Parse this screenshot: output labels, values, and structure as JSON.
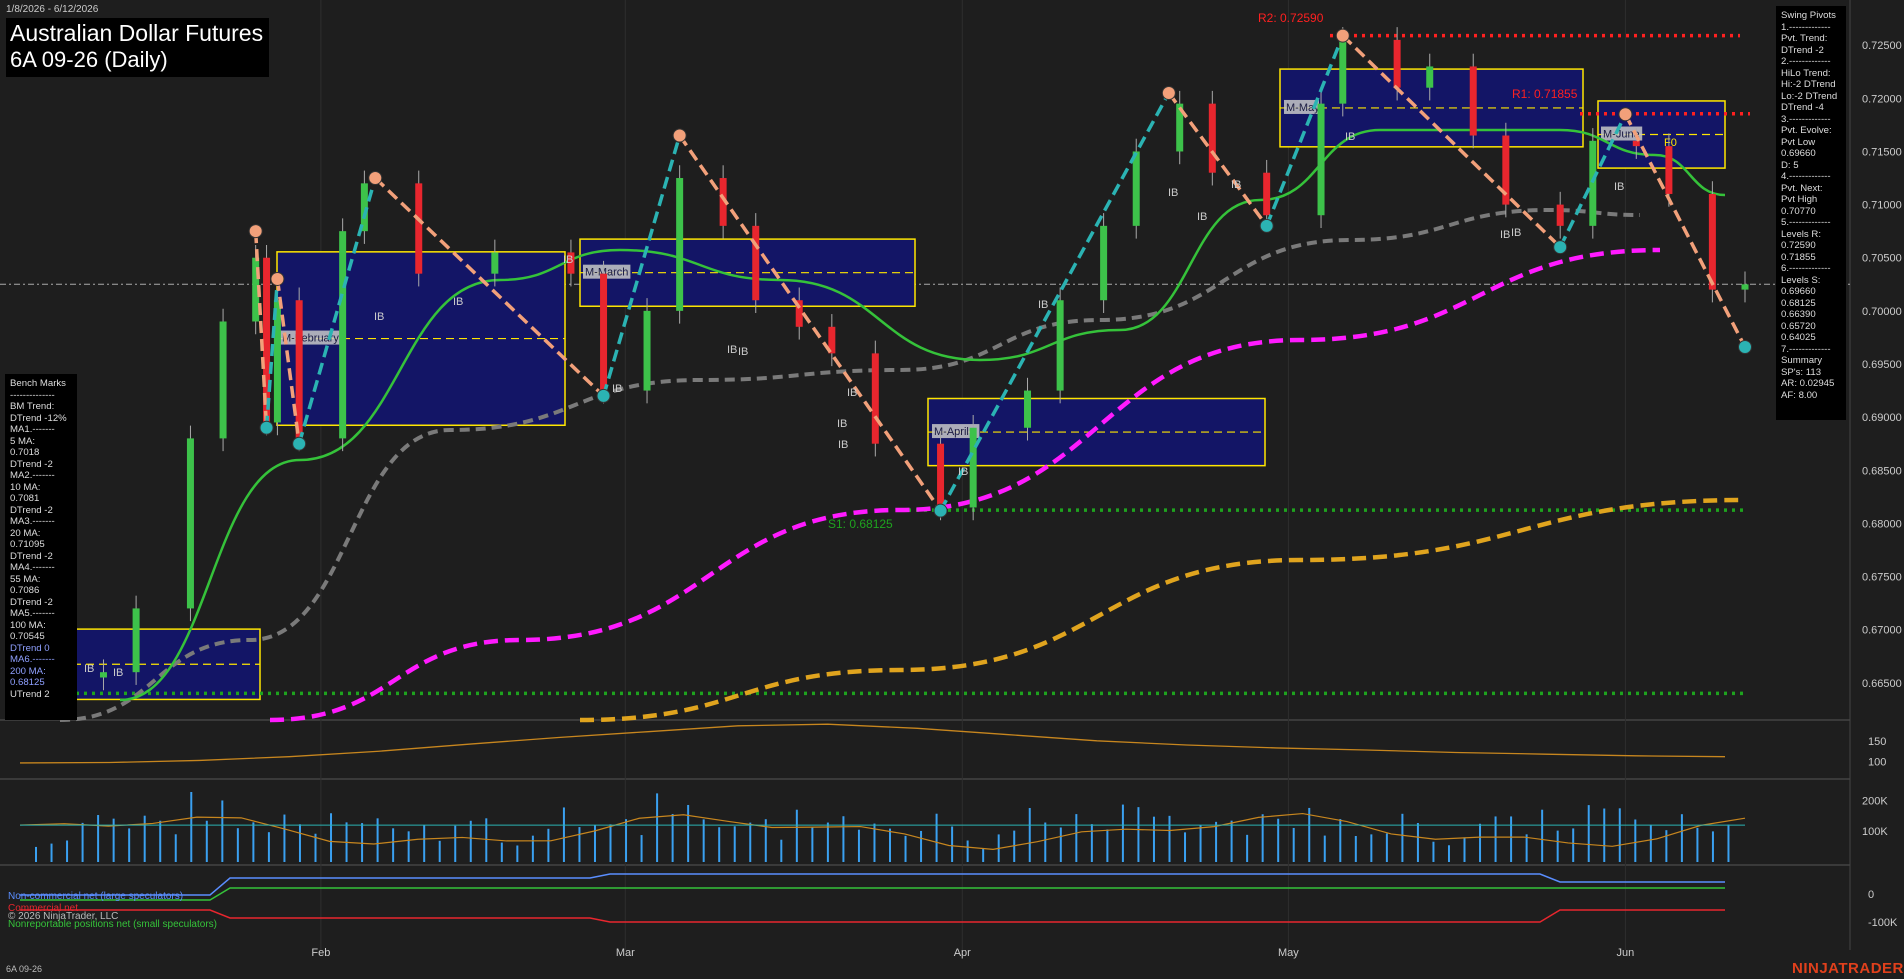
{
  "header": {
    "date_range": "1/8/2026 - 6/12/2026",
    "title": "Australian Dollar Futures",
    "subtitle": "6A 09-26 (Daily)"
  },
  "colors": {
    "background": "#1e1e1e",
    "up_candle": "#3dc24a",
    "down_candle": "#e8262e",
    "ma_green": "#35c23a",
    "ma_gray": "#7a7a7a",
    "ma_magenta": "#ff1aff",
    "ma_orange": "#e0a41e",
    "pivot_up_line": "#2bb3b3",
    "pivot_down_line": "#f2a07a",
    "resistance": "#ff2020",
    "support": "#1ea31e",
    "brand": "#e0401c"
  },
  "chart_data": [
    {
      "type": "candlestick",
      "title": "Australian Dollar Futures",
      "subtitle": "6A 09-26 (Daily)",
      "x_tick_labels": [
        "Feb",
        "Mar",
        "Apr",
        "May",
        "Jun"
      ],
      "y_tick_labels": [
        "0.72500",
        "0.72000",
        "0.71500",
        "0.71000",
        "0.70500",
        "0.70000",
        "0.69500",
        "0.69000",
        "0.68500",
        "0.68000",
        "0.67500",
        "0.67000",
        "0.66500"
      ],
      "ylim": [
        0.6615,
        0.7285
      ],
      "grid": false,
      "current_price": 0.7025,
      "close_series_approx": [
        {
          "date": "2026-01-08",
          "close": 0.6655
        },
        {
          "date": "2026-01-12",
          "close": 0.666
        },
        {
          "date": "2026-01-15",
          "close": 0.672
        },
        {
          "date": "2026-01-20",
          "close": 0.688
        },
        {
          "date": "2026-01-23",
          "close": 0.699
        },
        {
          "date": "2026-01-26",
          "close": 0.705
        },
        {
          "date": "2026-01-27",
          "close": 0.6895
        },
        {
          "date": "2026-01-28",
          "close": 0.701
        },
        {
          "date": "2026-01-30",
          "close": 0.688
        },
        {
          "date": "2026-02-03",
          "close": 0.7075
        },
        {
          "date": "2026-02-05",
          "close": 0.712
        },
        {
          "date": "2026-02-10",
          "close": 0.7035
        },
        {
          "date": "2026-02-17",
          "close": 0.7055
        },
        {
          "date": "2026-02-24",
          "close": 0.7035
        },
        {
          "date": "2026-02-27",
          "close": 0.6925
        },
        {
          "date": "2026-03-03",
          "close": 0.7
        },
        {
          "date": "2026-03-06",
          "close": 0.7125
        },
        {
          "date": "2026-03-10",
          "close": 0.708
        },
        {
          "date": "2026-03-13",
          "close": 0.701
        },
        {
          "date": "2026-03-17",
          "close": 0.6985
        },
        {
          "date": "2026-03-20",
          "close": 0.696
        },
        {
          "date": "2026-03-24",
          "close": 0.6875
        },
        {
          "date": "2026-03-30",
          "close": 0.6815
        },
        {
          "date": "2026-04-02",
          "close": 0.689
        },
        {
          "date": "2026-04-07",
          "close": 0.6925
        },
        {
          "date": "2026-04-10",
          "close": 0.701
        },
        {
          "date": "2026-04-14",
          "close": 0.708
        },
        {
          "date": "2026-04-17",
          "close": 0.715
        },
        {
          "date": "2026-04-21",
          "close": 0.7195
        },
        {
          "date": "2026-04-24",
          "close": 0.713
        },
        {
          "date": "2026-04-29",
          "close": 0.709
        },
        {
          "date": "2026-05-04",
          "close": 0.7195
        },
        {
          "date": "2026-05-06",
          "close": 0.7255
        },
        {
          "date": "2026-05-11",
          "close": 0.721
        },
        {
          "date": "2026-05-14",
          "close": 0.723
        },
        {
          "date": "2026-05-18",
          "close": 0.7165
        },
        {
          "date": "2026-05-21",
          "close": 0.71
        },
        {
          "date": "2026-05-26",
          "close": 0.708
        },
        {
          "date": "2026-05-29",
          "close": 0.716
        },
        {
          "date": "2026-06-02",
          "close": 0.7155
        },
        {
          "date": "2026-06-05",
          "close": 0.711
        },
        {
          "date": "2026-06-09",
          "close": 0.702
        },
        {
          "date": "2026-06-12",
          "close": 0.7025
        }
      ],
      "swing_pivots": [
        {
          "type": "high",
          "date": "2026-01-26",
          "price": 0.7075
        },
        {
          "type": "low",
          "date": "2026-01-27",
          "price": 0.689
        },
        {
          "type": "high",
          "date": "2026-01-28",
          "price": 0.703
        },
        {
          "type": "low",
          "date": "2026-01-30",
          "price": 0.6875
        },
        {
          "type": "high",
          "date": "2026-02-06",
          "price": 0.7125
        },
        {
          "type": "low",
          "date": "2026-02-27",
          "price": 0.692
        },
        {
          "type": "high",
          "date": "2026-03-06",
          "price": 0.7165
        },
        {
          "type": "low",
          "date": "2026-03-30",
          "price": 0.6812
        },
        {
          "type": "high",
          "date": "2026-04-20",
          "price": 0.7205
        },
        {
          "type": "low",
          "date": "2026-04-29",
          "price": 0.708
        },
        {
          "type": "high",
          "date": "2026-05-06",
          "price": 0.7259
        },
        {
          "type": "low",
          "date": "2026-05-26",
          "price": 0.706
        },
        {
          "type": "high",
          "date": "2026-06-01",
          "price": 0.7185
        },
        {
          "type": "low",
          "date": "2026-06-12",
          "price": 0.6966
        }
      ],
      "levels": [
        {
          "label": "R2: 0.72590",
          "value": 0.7259,
          "kind": "resistance"
        },
        {
          "label": "R1: 0.71855",
          "value": 0.71855,
          "kind": "resistance"
        },
        {
          "label": "S1: 0.68125",
          "value": 0.68125,
          "kind": "support"
        },
        {
          "label": "",
          "value": 0.664,
          "kind": "support"
        }
      ],
      "monthly_boxes": [
        {
          "label": "M-February",
          "high": 0.7048,
          "low": 0.6898
        },
        {
          "label": "M-March",
          "high": 0.706,
          "low": 0.701
        },
        {
          "label": "M-April",
          "high": 0.691,
          "low": 0.686
        },
        {
          "label": "M-May",
          "high": 0.722,
          "low": 0.716
        },
        {
          "label": "M-June",
          "high": 0.719,
          "low": 0.714
        },
        {
          "label": "",
          "high": 0.6693,
          "low": 0.664
        }
      ],
      "box_tags": [
        "F0"
      ],
      "inside_bar_tag": "IB",
      "moving_averages": [
        {
          "name": "20 MA",
          "color": "#35c23a",
          "value": 0.71095
        },
        {
          "name": "55 MA",
          "color": "#7a7a7a",
          "value": 0.7086
        },
        {
          "name": "100 MA",
          "color": "#ff1aff",
          "value": 0.70545
        },
        {
          "name": "200 MA",
          "color": "#e0a41e",
          "value": 0.68125
        }
      ]
    },
    {
      "type": "line",
      "title": "",
      "y_tick_labels": [
        "150",
        "100"
      ],
      "series": [
        {
          "values": [
            97,
            98,
            103,
            112,
            125,
            142,
            158,
            172,
            186,
            190,
            180,
            165,
            150,
            140,
            133,
            128,
            122,
            118,
            114,
            112
          ]
        }
      ]
    },
    {
      "type": "bar",
      "title": "",
      "y_tick_labels": [
        "200K",
        "100K"
      ],
      "ylim": [
        0,
        260000
      ],
      "series": [
        {
          "name": "Volume",
          "values": [
            70000,
            60000,
            90000,
            130000,
            180000,
            150000,
            120000,
            170000,
            140000,
            110000,
            230000,
            180000,
            200000,
            150000,
            130000,
            120000,
            160000,
            140000,
            100000,
            170000,
            150000,
            130000,
            180000,
            110000,
            140000,
            120000,
            90000,
            120000,
            160000,
            150000
          ]
        }
      ]
    },
    {
      "type": "line",
      "title": "",
      "y_tick_labels": [
        "0",
        "-100K"
      ],
      "series": [
        {
          "name": "Non-commercial net (large speculators)",
          "color": "#5a8eff"
        },
        {
          "name": "Commercial net",
          "color": "#e8262e"
        },
        {
          "name": "Nonreportable positions net (small speculators)",
          "color": "#35c23a"
        }
      ]
    }
  ],
  "bench_marks": {
    "title": "Bench Marks",
    "lines": [
      "--------------",
      "BM Trend:",
      "DTrend -12%",
      "MA1.-------",
      "5 MA:",
      "0.7018",
      "DTrend -2",
      "MA2.-------",
      "10 MA:",
      "0.7081",
      "DTrend -2",
      "MA3.-------",
      "20 MA:",
      "0.71095",
      "DTrend -2",
      "MA4.-------",
      "55 MA:",
      "0.7086",
      "DTrend -2",
      "MA5.-------",
      "100 MA:",
      "0.70545",
      "DTrend 0",
      "MA6.-------",
      "200 MA:",
      "0.68125",
      "UTrend 2"
    ]
  },
  "swing_pivots_panel": {
    "title": "Swing Pivots",
    "lines": [
      "1.-------------",
      "Pvt. Trend:",
      "DTrend -2",
      "2.-------------",
      "HiLo Trend:",
      "Hi:-2 DTrend",
      "Lo:-2 DTrend",
      "DTrend -4",
      "3.-------------",
      "Pvt. Evolve:",
      "Pvt Low",
      "0.69660",
      "D: 5",
      "4.-------------",
      "Pvt. Next:",
      "Pvt High",
      "0.70770",
      "5.-------------",
      "Levels R:",
      "0.72590",
      "0.71855",
      "6.-------------",
      "Levels S:",
      "0.69660",
      "0.68125",
      "0.66390",
      "0.65720",
      "0.64025",
      "7.-------------",
      "Summary",
      "SP's: 113",
      "AR: 0.02945",
      "AF: 8.00"
    ]
  },
  "legend": {
    "noncommercial": "Non-commercial net (large speculators)",
    "commercial": "Commercial net",
    "nonreportable": "Nonreportable positions net (small speculators)"
  },
  "footer": {
    "instrument": "6A 09-26",
    "copyright": "© 2026 NinjaTrader, LLC",
    "brand": "NINJATRADER"
  }
}
